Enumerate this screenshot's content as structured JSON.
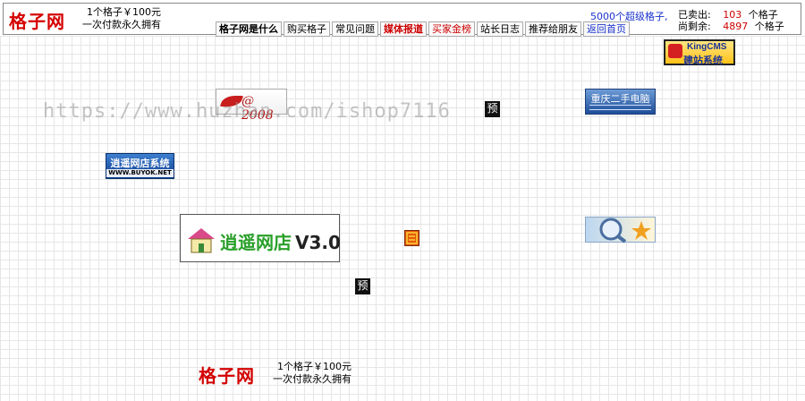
{
  "header": {
    "logo": "格子网",
    "slogan_line1": "1个格子￥100元",
    "slogan_line2": "一次付款永久拥有",
    "nav": [
      {
        "label": "格子网是什么",
        "style": "bold"
      },
      {
        "label": "购买格子",
        "style": "normal"
      },
      {
        "label": "常见问题",
        "style": "normal"
      },
      {
        "label": "媒体报道",
        "style": "red"
      },
      {
        "label": "买家金榜",
        "style": "red2"
      },
      {
        "label": "站长日志",
        "style": "normal"
      },
      {
        "label": "推荐给朋友",
        "style": "normal"
      },
      {
        "label": "返回首页",
        "style": "blue"
      }
    ],
    "super_link": "5000个超级格子,",
    "sold_label": "已卖出:",
    "sold_value": "103",
    "sold_unit": "个格子",
    "remaining_label": "尚剩余:",
    "remaining_value": "4897",
    "remaining_unit": "个格子"
  },
  "watermark": "https://www.huzhan.com/ishop7116",
  "ads": {
    "kingcms_line1": "KingCMS",
    "kingcms_line2": "建站系统",
    "at2008": "@ 2008",
    "preview1": "预",
    "preview2": "预",
    "chongqing": "重庆二手电脑",
    "xiaoyao_small_line1": "逍遥网店系统",
    "xiaoyao_small_line2": "WWW.BUYOK.NET",
    "xiaoyao_big": "逍遥网店",
    "xiaoyao_version": "V3.0"
  },
  "footer": {
    "logo": "格子网",
    "slogan_line1": "1个格子￥100元",
    "slogan_line2": "一次付款永久拥有"
  }
}
